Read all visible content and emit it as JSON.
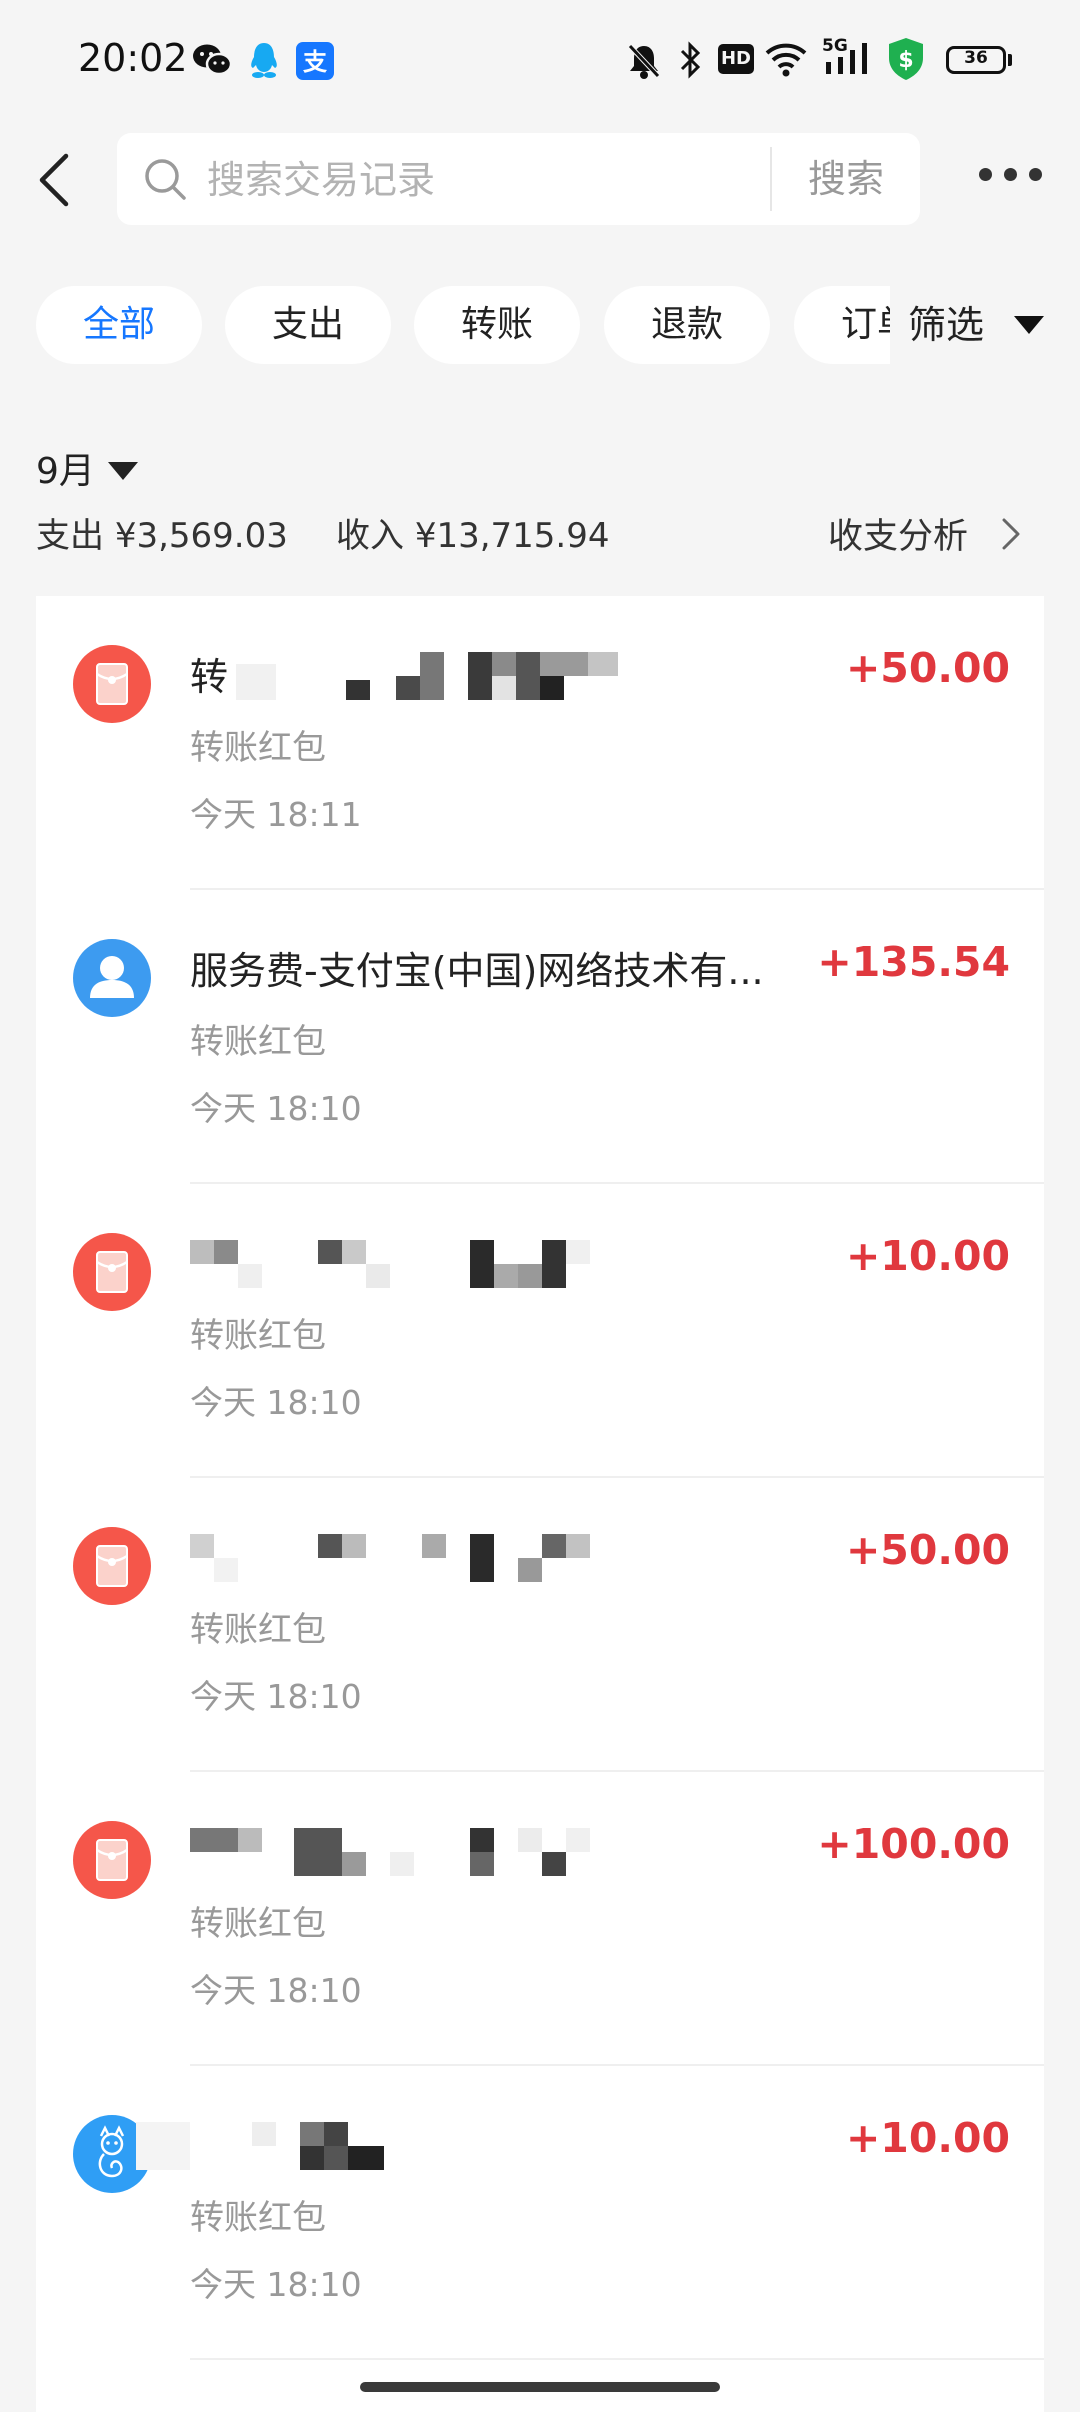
{
  "status_bar": {
    "time": "20:02",
    "hd_badge": "HD",
    "network": "5G",
    "battery": "36",
    "app_icons": [
      "wechat-icon",
      "qq-icon",
      "alipay-icon"
    ]
  },
  "header": {
    "search": {
      "placeholder": "搜索交易记录",
      "value": "",
      "button_label": "搜索"
    }
  },
  "filters": {
    "chips": [
      {
        "label": "全部",
        "active": true
      },
      {
        "label": "支出",
        "active": false
      },
      {
        "label": "转账",
        "active": false
      },
      {
        "label": "退款",
        "active": false
      },
      {
        "label": "订单",
        "active": false
      }
    ],
    "filter_label": "筛选"
  },
  "month_section": {
    "month": "9月",
    "expense_label": "支出",
    "expense": "¥3,569.03",
    "income_label": "收入",
    "income": "¥13,715.94",
    "analysis_label": "收支分析"
  },
  "transactions": [
    {
      "icon": "red-packet-icon",
      "title": "转",
      "category": "转账红包",
      "time": "今天 18:11",
      "amount": "+50.00"
    },
    {
      "icon": "person-avatar-icon",
      "title": "服务费-支付宝(中国)网络技术有...",
      "category": "转账红包",
      "time": "今天 18:10",
      "amount": "+135.54"
    },
    {
      "icon": "red-packet-icon",
      "title": "",
      "category": "转账红包",
      "time": "今天 18:10",
      "amount": "+10.00"
    },
    {
      "icon": "red-packet-icon",
      "title": "",
      "category": "转账红包",
      "time": "今天 18:10",
      "amount": "+50.00"
    },
    {
      "icon": "red-packet-icon",
      "title": "",
      "category": "转账红包",
      "time": "今天 18:10",
      "amount": "+100.00"
    },
    {
      "icon": "cat-avatar-icon",
      "title": "",
      "category": "转账红包",
      "time": "今天 18:10",
      "amount": "+10.00"
    }
  ],
  "colors": {
    "accent": "#1677ff",
    "income": "#e0383e",
    "red_packet": "#f5564a",
    "avatar_blue": "#3d9bf0",
    "background": "#f5f5f5"
  }
}
